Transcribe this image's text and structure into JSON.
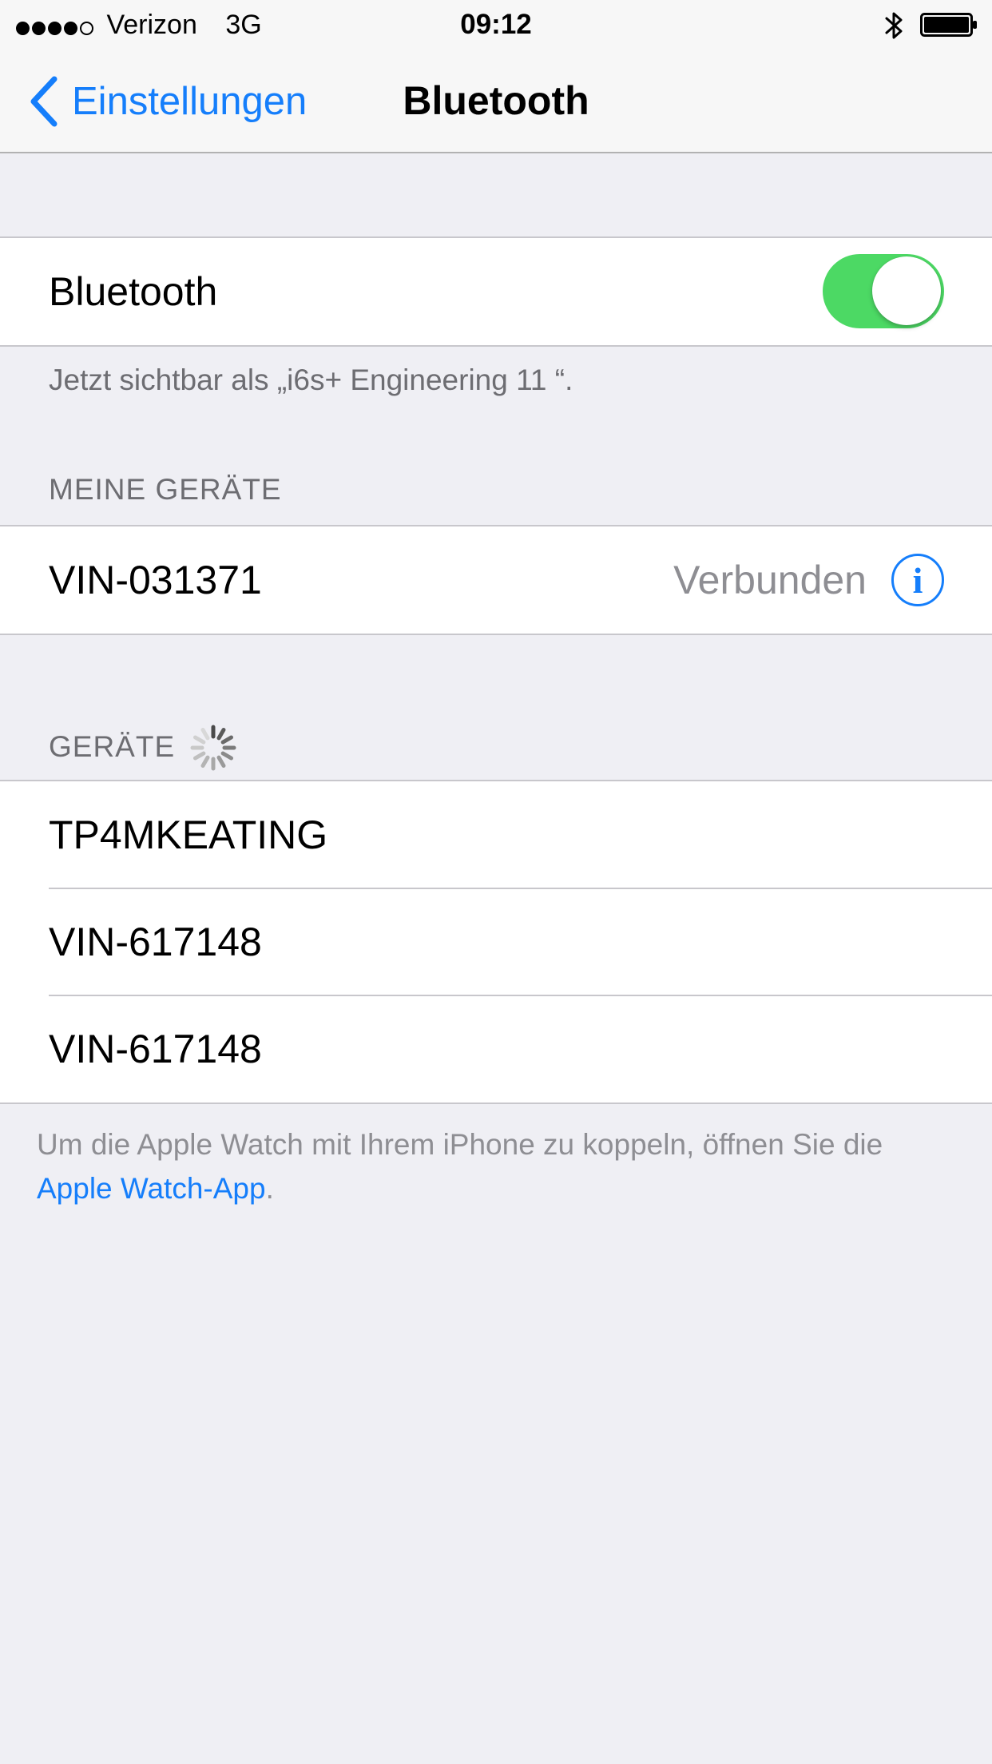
{
  "status_bar": {
    "carrier": "Verizon",
    "network": "3G",
    "time": "09:12",
    "signal_bars_filled": 4,
    "signal_bars_total": 5,
    "icons": [
      "bluetooth-icon",
      "battery-icon"
    ]
  },
  "nav": {
    "back_label": "Einstellungen",
    "title": "Bluetooth"
  },
  "bluetooth_toggle": {
    "label": "Bluetooth",
    "on": true,
    "color": "#4cd964"
  },
  "visibility_note": "Jetzt sichtbar als „i6s+ Engineering 11 “.",
  "my_devices": {
    "header": "MEINE GERÄTE",
    "items": [
      {
        "name": "VIN-031371",
        "status": "Verbunden",
        "info_icon": "info-icon"
      }
    ]
  },
  "devices": {
    "header": "GERÄTE",
    "items": [
      {
        "name": "TP4MKEATING"
      },
      {
        "name": "VIN-617148"
      },
      {
        "name": "VIN-617148"
      }
    ]
  },
  "watch_note": {
    "text": "Um die Apple Watch mit Ihrem iPhone zu koppeln, öffnen Sie die ",
    "link": "Apple Watch-App",
    "suffix": "."
  },
  "colors": {
    "accent": "#157efb",
    "background": "#efeff4",
    "secondary_text": "#8e8e93"
  }
}
